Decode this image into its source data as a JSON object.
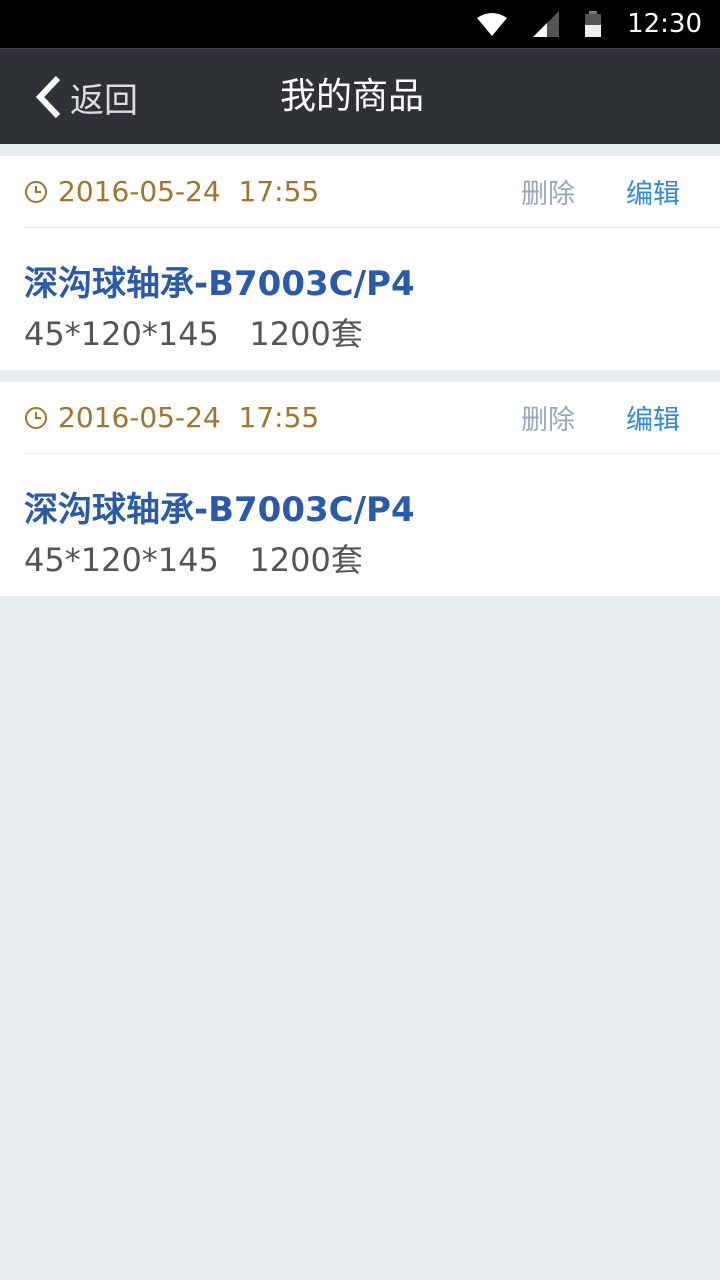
{
  "status_bar": {
    "time": "12:30",
    "icons": [
      "wifi-icon",
      "signal-icon",
      "battery-icon"
    ]
  },
  "header": {
    "back_label": "返回",
    "title": "我的商品"
  },
  "items": [
    {
      "date": "2016-05-24  17:55",
      "delete_label": "删除",
      "edit_label": "编辑",
      "name": "深沟球轴承-B7003C/P4",
      "spec": "45*120*145",
      "quantity": "1200套"
    },
    {
      "date": "2016-05-24  17:55",
      "delete_label": "删除",
      "edit_label": "编辑",
      "name": "深沟球轴承-B7003C/P4",
      "spec": "45*120*145",
      "quantity": "1200套"
    }
  ],
  "colors": {
    "header_bg": "#2e3236",
    "date": "#a2742f",
    "name": "#2a5aa8",
    "edit": "#2f8ae2",
    "delete": "#9aa6bb"
  }
}
